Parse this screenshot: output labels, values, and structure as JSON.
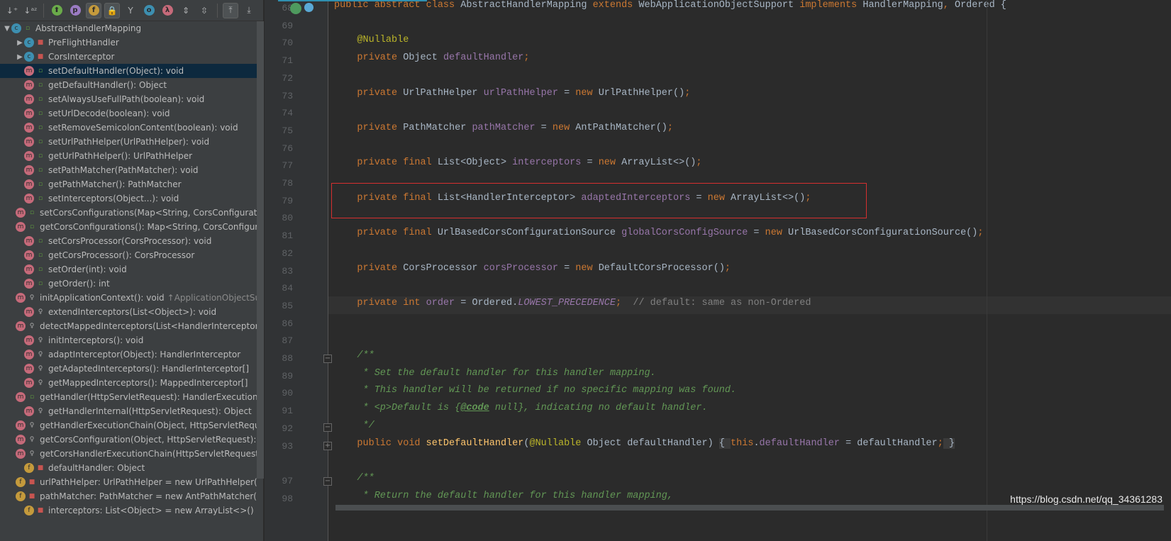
{
  "toolbar": {
    "buttons": [
      {
        "icon": "sort-by-visibility-icon",
        "glyph": "↓⁺",
        "on": false
      },
      {
        "icon": "sort-alphabetically-icon",
        "glyph": "↓ᵃᶻ",
        "on": false
      },
      {
        "icon": "show-inherited-icon",
        "glyph": "⬆",
        "color": "#6aab4a",
        "on": false
      },
      {
        "icon": "show-properties-icon",
        "glyph": "p",
        "color": "#9b7bc4",
        "on": false
      },
      {
        "icon": "show-fields-icon",
        "glyph": "f",
        "color": "#c49a3c",
        "on": true
      },
      {
        "icon": "show-non-public-icon",
        "glyph": "🔒",
        "on": true
      },
      {
        "icon": "show-anonymous-icon",
        "glyph": "Y",
        "on": false
      },
      {
        "icon": "show-lambdas-icon",
        "glyph": "o",
        "color": "#3d8fb0",
        "on": false
      },
      {
        "icon": "show-lambda-icon",
        "glyph": "λ",
        "color": "#c66a7a",
        "on": false
      },
      {
        "icon": "expand-all-icon",
        "glyph": "⇕",
        "on": false
      },
      {
        "icon": "collapse-all-icon",
        "glyph": "⇳",
        "on": false
      },
      {
        "icon": "autoscroll-to-source-icon",
        "glyph": "⤒",
        "on": true
      },
      {
        "icon": "autoscroll-from-source-icon",
        "glyph": "⤓",
        "on": false
      }
    ]
  },
  "tree": [
    {
      "arrow": "▼",
      "icon": "c",
      "acc": "pub",
      "text": "AbstractHandlerMapping",
      "indent": 0
    },
    {
      "arrow": "▶",
      "icon": "c",
      "acc": "pri",
      "text": "PreFlightHandler",
      "indent": 1
    },
    {
      "arrow": "▶",
      "icon": "c",
      "acc": "pri",
      "text": "CorsInterceptor",
      "indent": 1
    },
    {
      "icon": "m",
      "acc": "pub",
      "text": "setDefaultHandler(Object): void",
      "indent": 1,
      "selected": true
    },
    {
      "icon": "m",
      "acc": "pub",
      "text": "getDefaultHandler(): Object",
      "indent": 1
    },
    {
      "icon": "m",
      "acc": "pub",
      "text": "setAlwaysUseFullPath(boolean): void",
      "indent": 1
    },
    {
      "icon": "m",
      "acc": "pub",
      "text": "setUrlDecode(boolean): void",
      "indent": 1
    },
    {
      "icon": "m",
      "acc": "pub",
      "text": "setRemoveSemicolonContent(boolean): void",
      "indent": 1
    },
    {
      "icon": "m",
      "acc": "pub",
      "text": "setUrlPathHelper(UrlPathHelper): void",
      "indent": 1
    },
    {
      "icon": "m",
      "acc": "pub",
      "text": "getUrlPathHelper(): UrlPathHelper",
      "indent": 1
    },
    {
      "icon": "m",
      "acc": "pub",
      "text": "setPathMatcher(PathMatcher): void",
      "indent": 1
    },
    {
      "icon": "m",
      "acc": "pub",
      "text": "getPathMatcher(): PathMatcher",
      "indent": 1
    },
    {
      "icon": "m",
      "acc": "pub",
      "text": "setInterceptors(Object...): void",
      "indent": 1
    },
    {
      "icon": "m",
      "acc": "pub",
      "text": "setCorsConfigurations(Map<String, CorsConfiguration>): void",
      "indent": 1
    },
    {
      "icon": "m",
      "acc": "pub",
      "text": "getCorsConfigurations(): Map<String, CorsConfiguration>",
      "indent": 1
    },
    {
      "icon": "m",
      "acc": "pub",
      "text": "setCorsProcessor(CorsProcessor): void",
      "indent": 1
    },
    {
      "icon": "m",
      "acc": "pub",
      "text": "getCorsProcessor(): CorsProcessor",
      "indent": 1
    },
    {
      "icon": "m",
      "acc": "pub",
      "text": "setOrder(int): void",
      "indent": 1
    },
    {
      "icon": "m",
      "acc": "pub",
      "text": "getOrder(): int",
      "indent": 1
    },
    {
      "icon": "m",
      "acc": "pro",
      "text": "initApplicationContext(): void",
      "extra": "↑ApplicationObjectSupport",
      "indent": 1
    },
    {
      "icon": "m",
      "acc": "pro",
      "text": "extendInterceptors(List<Object>): void",
      "indent": 1
    },
    {
      "icon": "m",
      "acc": "pro",
      "text": "detectMappedInterceptors(List<HandlerInterceptor>): void",
      "indent": 1
    },
    {
      "icon": "m",
      "acc": "pro",
      "text": "initInterceptors(): void",
      "indent": 1
    },
    {
      "icon": "m",
      "acc": "pro",
      "text": "adaptInterceptor(Object): HandlerInterceptor",
      "indent": 1
    },
    {
      "icon": "m",
      "acc": "pro",
      "text": "getAdaptedInterceptors(): HandlerInterceptor[]",
      "indent": 1
    },
    {
      "icon": "m",
      "acc": "pro",
      "text": "getMappedInterceptors(): MappedInterceptor[]",
      "indent": 1
    },
    {
      "icon": "m",
      "acc": "pub",
      "text": "getHandler(HttpServletRequest): HandlerExecutionChain",
      "indent": 1
    },
    {
      "icon": "m",
      "acc": "pro",
      "text": "getHandlerInternal(HttpServletRequest): Object",
      "indent": 1
    },
    {
      "icon": "m",
      "acc": "pro",
      "text": "getHandlerExecutionChain(Object, HttpServletRequest): HandlerExecutionChain",
      "indent": 1
    },
    {
      "icon": "m",
      "acc": "pro",
      "text": "getCorsConfiguration(Object, HttpServletRequest): CorsConfiguration",
      "indent": 1
    },
    {
      "icon": "m",
      "acc": "pro",
      "text": "getCorsHandlerExecutionChain(HttpServletRequest, HandlerExecutionChain, CorsConfiguration)",
      "indent": 1
    },
    {
      "icon": "f",
      "acc": "pri",
      "text": "defaultHandler: Object",
      "indent": 1
    },
    {
      "icon": "f",
      "acc": "pri",
      "text": "urlPathHelper: UrlPathHelper = new UrlPathHelper()",
      "indent": 1
    },
    {
      "icon": "f",
      "acc": "pri",
      "text": "pathMatcher: PathMatcher = new AntPathMatcher()",
      "indent": 1
    },
    {
      "icon": "f",
      "acc": "pri",
      "text": "interceptors: List<Object> = new ArrayList<>()",
      "indent": 1
    }
  ],
  "editor": {
    "lines": [
      {
        "n": "68",
        "t": [
          [
            "public abstract class ",
            "kw"
          ],
          [
            "AbstractHandlerMapping ",
            ""
          ],
          [
            "extends ",
            "kw"
          ],
          [
            "WebApplicationObjectSupport ",
            ""
          ],
          [
            "implements ",
            "kw"
          ],
          [
            "HandlerMapping",
            ""
          ],
          [
            ", ",
            "kw"
          ],
          [
            "Ordered {",
            ""
          ]
        ]
      },
      {
        "n": "69",
        "t": []
      },
      {
        "n": "70",
        "t": [
          [
            "    ",
            ""
          ],
          [
            "@Nullable",
            "ann"
          ]
        ]
      },
      {
        "n": "71",
        "t": [
          [
            "    private ",
            "kw"
          ],
          [
            "Object ",
            ""
          ],
          [
            "defaultHandler",
            "fld"
          ],
          [
            ";",
            "kw"
          ]
        ]
      },
      {
        "n": "72",
        "t": []
      },
      {
        "n": "73",
        "t": [
          [
            "    private ",
            "kw"
          ],
          [
            "UrlPathHelper ",
            ""
          ],
          [
            "urlPathHelper",
            "fld"
          ],
          [
            " = ",
            ""
          ],
          [
            "new ",
            "kw"
          ],
          [
            "UrlPathHelper()",
            ""
          ],
          [
            ";",
            "kw"
          ]
        ]
      },
      {
        "n": "74",
        "t": []
      },
      {
        "n": "75",
        "t": [
          [
            "    private ",
            "kw"
          ],
          [
            "PathMatcher ",
            ""
          ],
          [
            "pathMatcher",
            "fld"
          ],
          [
            " = ",
            ""
          ],
          [
            "new ",
            "kw"
          ],
          [
            "AntPathMatcher()",
            ""
          ],
          [
            ";",
            "kw"
          ]
        ]
      },
      {
        "n": "76",
        "t": []
      },
      {
        "n": "77",
        "t": [
          [
            "    private final ",
            "kw"
          ],
          [
            "List<Object> ",
            ""
          ],
          [
            "interceptors",
            "fld"
          ],
          [
            " = ",
            ""
          ],
          [
            "new ",
            "kw"
          ],
          [
            "ArrayList<>()",
            ""
          ],
          [
            ";",
            "kw"
          ]
        ]
      },
      {
        "n": "78",
        "t": []
      },
      {
        "n": "79",
        "t": [
          [
            "    private final ",
            "kw"
          ],
          [
            "List<HandlerInterceptor> ",
            ""
          ],
          [
            "adaptedInterceptors",
            "fld"
          ],
          [
            " = ",
            ""
          ],
          [
            "new ",
            "kw"
          ],
          [
            "ArrayList<>()",
            ""
          ],
          [
            ";",
            "kw"
          ]
        ]
      },
      {
        "n": "80",
        "t": []
      },
      {
        "n": "81",
        "t": [
          [
            "    private final ",
            "kw"
          ],
          [
            "UrlBasedCorsConfigurationSource ",
            ""
          ],
          [
            "globalCorsConfigSource",
            "fld"
          ],
          [
            " = ",
            ""
          ],
          [
            "new ",
            "kw"
          ],
          [
            "UrlBasedCorsConfigurationSource()",
            ""
          ],
          [
            ";",
            "kw"
          ]
        ]
      },
      {
        "n": "82",
        "t": []
      },
      {
        "n": "83",
        "t": [
          [
            "    private ",
            "kw"
          ],
          [
            "CorsProcessor ",
            ""
          ],
          [
            "corsProcessor",
            "fld"
          ],
          [
            " = ",
            ""
          ],
          [
            "new ",
            "kw"
          ],
          [
            "DefaultCorsProcessor()",
            ""
          ],
          [
            ";",
            "kw"
          ]
        ]
      },
      {
        "n": "84",
        "t": []
      },
      {
        "n": "85",
        "t": [
          [
            "    private int ",
            "kw"
          ],
          [
            "order",
            "fld"
          ],
          [
            " = Ordered.",
            ""
          ],
          [
            "LOWEST_PRECEDENCE",
            "st"
          ],
          [
            ";  ",
            "kw"
          ],
          [
            "// default: same as non-Ordered",
            "cm"
          ]
        ]
      },
      {
        "n": "86",
        "t": []
      },
      {
        "n": "87",
        "t": []
      },
      {
        "n": "88",
        "t": [
          [
            "    /**",
            "doc"
          ]
        ]
      },
      {
        "n": "89",
        "t": [
          [
            "     * Set the default handler for this handler mapping.",
            "doc"
          ]
        ]
      },
      {
        "n": "90",
        "t": [
          [
            "     * This handler will be returned if no specific mapping was found.",
            "doc"
          ]
        ]
      },
      {
        "n": "91",
        "t": [
          [
            "     * <p>Default is {",
            "doc"
          ],
          [
            "@code",
            "docb"
          ],
          [
            " null}, indicating no default handler.",
            "doc"
          ]
        ]
      },
      {
        "n": "92",
        "t": [
          [
            "     */",
            "doc"
          ]
        ]
      },
      {
        "n": "93",
        "t": [
          [
            "    public void ",
            "kw"
          ],
          [
            "setDefaultHandler",
            "md"
          ],
          [
            "(",
            ""
          ],
          [
            "@Nullable ",
            "ann"
          ],
          [
            "Object defaultHandler) ",
            ""
          ],
          [
            "{ ",
            "brk"
          ],
          [
            "this",
            "kw"
          ],
          [
            ".",
            ""
          ],
          [
            "defaultHandler",
            "fld"
          ],
          [
            " = defaultHandler",
            ""
          ],
          [
            ";",
            "kw"
          ],
          [
            " }",
            "brk"
          ]
        ]
      },
      {
        "n": "97",
        "t": []
      },
      {
        "n": "97",
        "t": [
          [
            "    /**",
            "doc"
          ]
        ]
      },
      {
        "n": "98",
        "t": [
          [
            "     * Return the default handler for this handler mapping,",
            "doc"
          ]
        ]
      }
    ]
  },
  "watermark": "https://blog.csdn.net/qq_34361283",
  "colors": {
    "keyword": "#cc7832",
    "field": "#9876aa",
    "annotation": "#bbb529",
    "doc_comment": "#629755",
    "highlight_box": "#d62f2f"
  }
}
